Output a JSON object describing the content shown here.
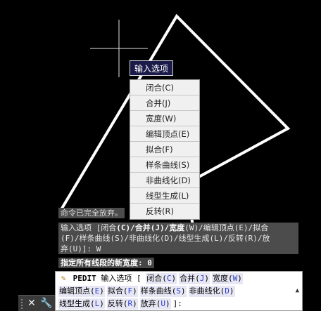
{
  "tooltip": {
    "text": "输入选项"
  },
  "context_menu": {
    "items": [
      "闭合(C)",
      "合并(J)",
      "宽度(W)",
      "编辑顶点(E)",
      "拟合(F)",
      "样条曲线(S)",
      "非曲线化(D)",
      "线型生成(L)",
      "反转(R)"
    ]
  },
  "history": {
    "line1": "命令已完全放弃。",
    "prompt_prefix": "输入选项 [闭合",
    "prompt_selected": "(C)/合并(J)/宽度",
    "prompt_rest1": "(W)/编辑顶点(E)/拟合",
    "prompt_line2": "(F)/样条曲线(S)/非曲线化(D)/线型生成(L)/反转(R)/放",
    "prompt_line3": "弃(U)]: W",
    "line3": "指定所有线段的新宽度: 0"
  },
  "command_line": {
    "command": "PEDIT",
    "prompt": "输入选项 [",
    "options_row1": [
      {
        "label": "闭合(",
        "key": "C",
        "tail": ")"
      },
      {
        "label": "合并(",
        "key": "J",
        "tail": ")"
      },
      {
        "label": "宽度(",
        "key": "W",
        "tail": ")"
      }
    ],
    "options_row2": [
      {
        "label": "编辑顶点(",
        "key": "E",
        "tail": ")"
      },
      {
        "label": "拟合(",
        "key": "F",
        "tail": ")"
      },
      {
        "label": "样条曲线(",
        "key": "S",
        "tail": ")"
      },
      {
        "label": "非曲线化(",
        "key": "D",
        "tail": ")"
      }
    ],
    "options_row3": [
      {
        "label": "线型生成(",
        "key": "L",
        "tail": ")"
      },
      {
        "label": "反转(",
        "key": "R",
        "tail": ")"
      },
      {
        "label": "放弃(",
        "key": "U",
        "tail": ")"
      }
    ],
    "end": "]:",
    "scroll_arrow": "▲"
  },
  "dock": {
    "close": "✕",
    "customize": "🔧"
  },
  "icons": {
    "pencil": "pencil-icon",
    "close": "close-icon",
    "wrench": "wrench-icon"
  },
  "colors": {
    "background": "#000000",
    "geometry": "#ffffff",
    "option_key": "#2a3fd0"
  }
}
